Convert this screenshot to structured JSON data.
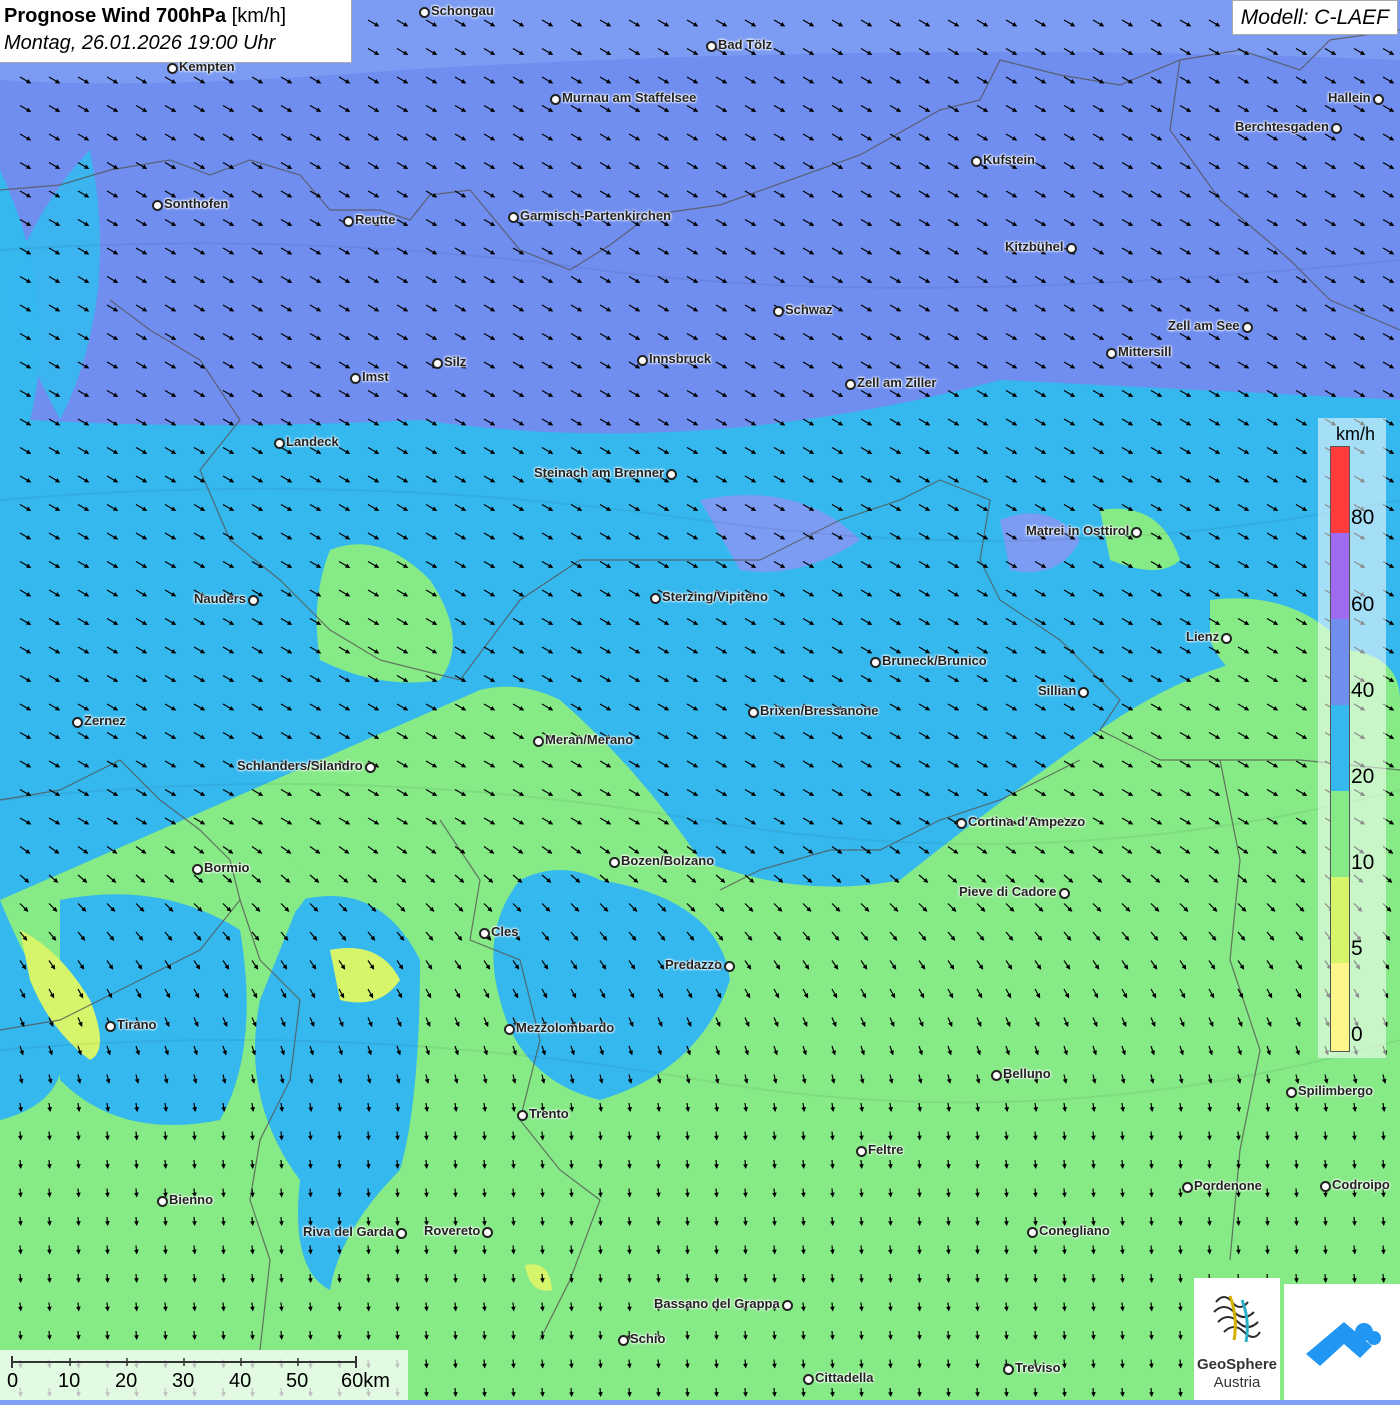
{
  "header": {
    "title_bold": "Prognose Wind 700hPa",
    "title_unit": "[km/h]",
    "datetime": "Montag, 26.01.2026 19:00 Uhr"
  },
  "model": "Modell: C-LAEF",
  "legend": {
    "unit": "km/h",
    "ticks": [
      "80",
      "60",
      "40",
      "20",
      "10",
      "5",
      "0"
    ],
    "colors": [
      "#ff3b3b",
      "#9f6bf0",
      "#6f8ef0",
      "#35b8ee",
      "#86ea86",
      "#d7f56a",
      "#fbf58a"
    ]
  },
  "scalebar": {
    "labels": [
      "0",
      "10",
      "20",
      "30",
      "40",
      "50",
      "60km"
    ]
  },
  "logos": {
    "geosphere_line1": "GeoSphere",
    "geosphere_line2": "Austria"
  },
  "cities": [
    {
      "name": "Schongau"
    },
    {
      "name": "Bad Tölz"
    },
    {
      "name": "Kempten"
    },
    {
      "name": "Murnau am Staffelsee"
    },
    {
      "name": "Hallein"
    },
    {
      "name": "Berchtesgaden"
    },
    {
      "name": "Kufstein"
    },
    {
      "name": "Sonthofen"
    },
    {
      "name": "Reutte"
    },
    {
      "name": "Garmisch-Partenkirchen"
    },
    {
      "name": "Kitzbühel"
    },
    {
      "name": "Schwaz"
    },
    {
      "name": "Zell am See"
    },
    {
      "name": "Mittersill"
    },
    {
      "name": "Innsbruck"
    },
    {
      "name": "Silz"
    },
    {
      "name": "Imst"
    },
    {
      "name": "Zell am Ziller"
    },
    {
      "name": "Landeck"
    },
    {
      "name": "Steinach am Brenner"
    },
    {
      "name": "Matrei in Osttirol"
    },
    {
      "name": "Nauders"
    },
    {
      "name": "Sterzing/Vipiteno"
    },
    {
      "name": "Lienz"
    },
    {
      "name": "Bruneck/Brunico"
    },
    {
      "name": "Sillian"
    },
    {
      "name": "Brixen/Bressanone"
    },
    {
      "name": "Zernez"
    },
    {
      "name": "Meran/Merano"
    },
    {
      "name": "Schlanders/Silandro"
    },
    {
      "name": "Cortina d'Ampezzo"
    },
    {
      "name": "Bozen/Bolzano"
    },
    {
      "name": "Bormio"
    },
    {
      "name": "Pieve di Cadore"
    },
    {
      "name": "Cles"
    },
    {
      "name": "Predazzo"
    },
    {
      "name": "Tirano"
    },
    {
      "name": "Mezzolombardo"
    },
    {
      "name": "Belluno"
    },
    {
      "name": "Spilimbergo"
    },
    {
      "name": "Trento"
    },
    {
      "name": "Feltre"
    },
    {
      "name": "Pordenone"
    },
    {
      "name": "Codroipo"
    },
    {
      "name": "Bienno"
    },
    {
      "name": "Riva del Garda"
    },
    {
      "name": "Rovereto"
    },
    {
      "name": "Conegliano"
    },
    {
      "name": "Bassano del Grappa"
    },
    {
      "name": "Schio"
    },
    {
      "name": "Treviso"
    },
    {
      "name": "Cittadella"
    }
  ]
}
